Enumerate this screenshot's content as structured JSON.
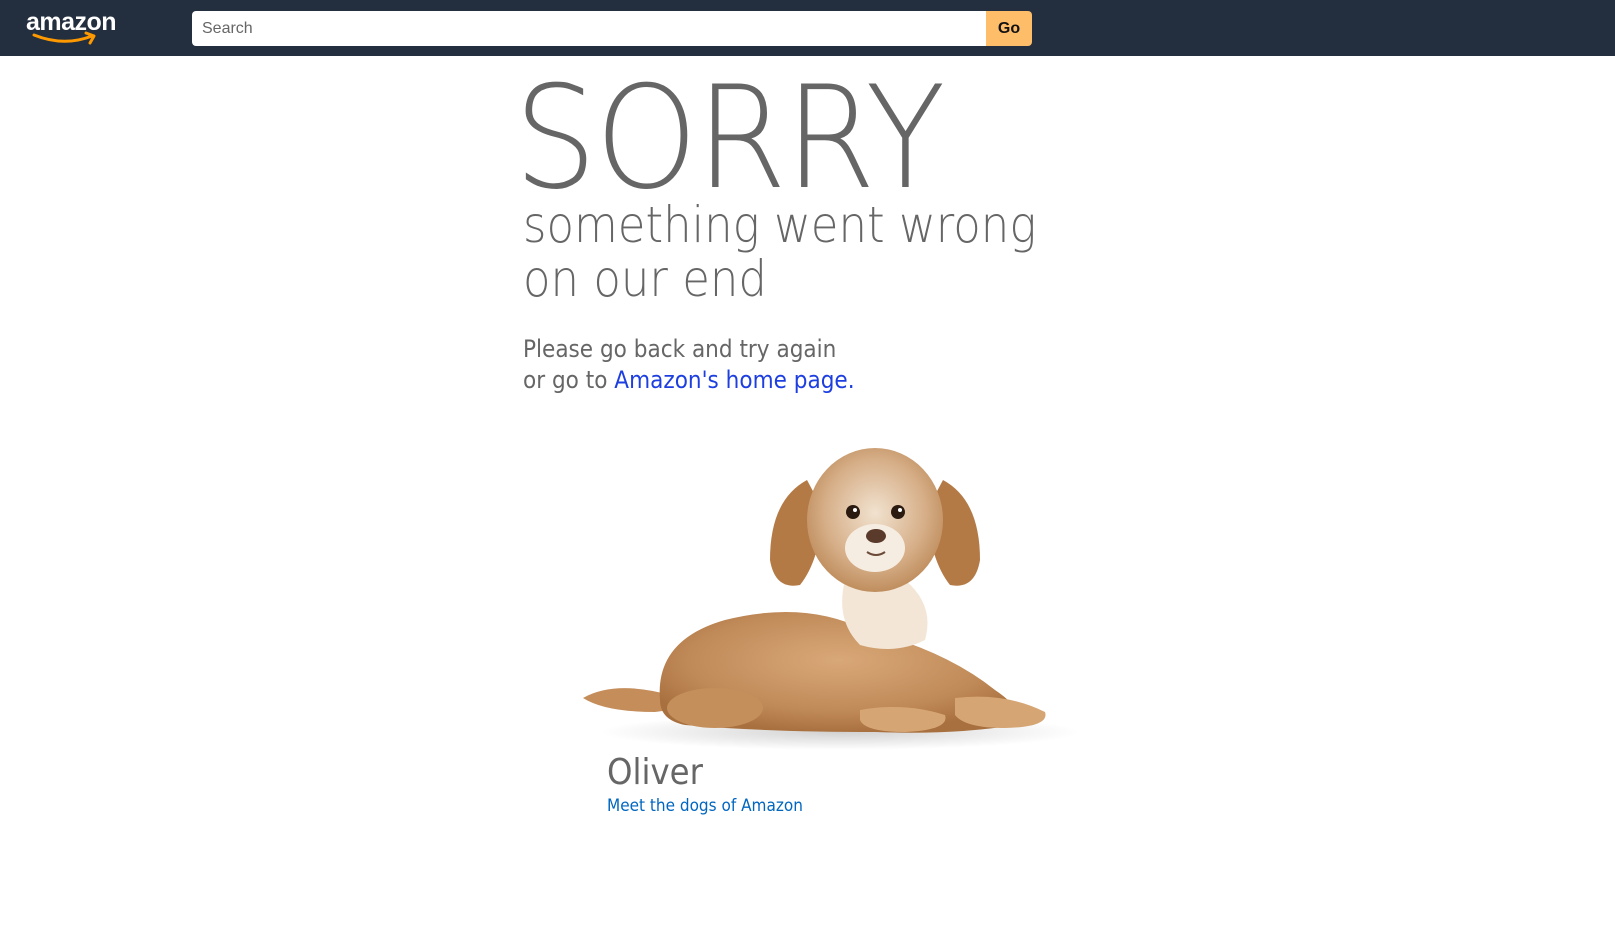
{
  "header": {
    "logo_text": "amazon",
    "search": {
      "placeholder": "Search",
      "value": ""
    },
    "go_label": "Go"
  },
  "main": {
    "headline": "SORRY",
    "subheadline_line1": "something went wrong",
    "subheadline_line2": "on our end",
    "message_line1": "Please go back and try again",
    "message_line2_prefix": "or go to ",
    "home_link_label": "Amazon's home page.",
    "dog": {
      "name": "Oliver",
      "link_label": "Meet the dogs of Amazon"
    }
  },
  "colors": {
    "navbar": "#232f3e",
    "go_button": "#febd69",
    "text_gray": "#666666",
    "link_blue": "#1e3fe0",
    "dogs_link_blue": "#0066c0"
  }
}
